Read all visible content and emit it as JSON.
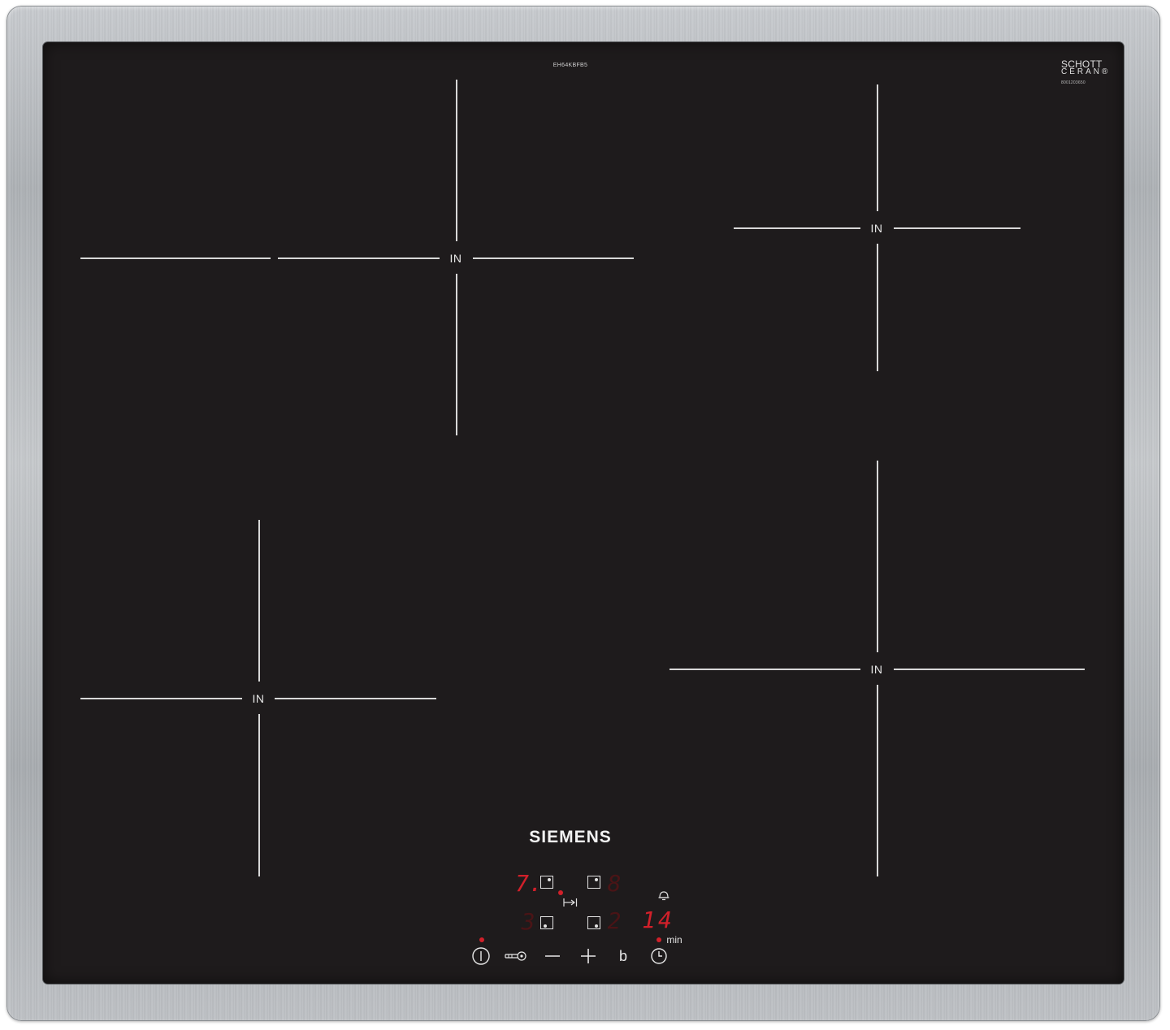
{
  "product": {
    "model_code": "EH64KBFB5",
    "glass_brand_line1": "SCHOTT",
    "glass_brand_line2": "CERAN®",
    "glass_serial": "8001203650",
    "brand": "SIEMENS"
  },
  "zones": [
    {
      "id": "front-left-large",
      "label": "IN"
    },
    {
      "id": "rear-right",
      "label": "IN"
    },
    {
      "id": "front-left-small",
      "label": "IN"
    },
    {
      "id": "front-right",
      "label": "IN"
    }
  ],
  "control_panel": {
    "display_rear_left": "7.",
    "display_rear_right": "8",
    "display_front_left": "3",
    "display_front_right": "2",
    "timer_display": "14",
    "timer_unit": "min",
    "buttons": {
      "power": "power-icon",
      "lock": "key-lock-icon",
      "minus": "−",
      "plus": "+",
      "boost": "b",
      "timer": "clock-icon",
      "alarm": "bell-icon",
      "transfer": "move-to-icon"
    }
  },
  "colors": {
    "glass": "#1e1b1c",
    "frame": "#b8bbbf",
    "display_red": "#d1202a",
    "markings": "#d8d8d8"
  }
}
